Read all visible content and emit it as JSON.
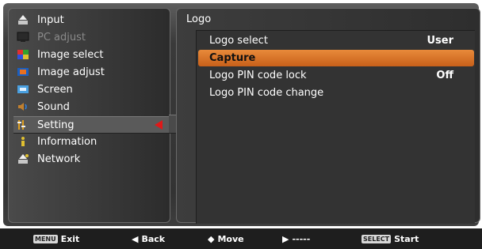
{
  "left_menu": {
    "items": [
      {
        "label": "Input",
        "icon": "input-icon",
        "disabled": false
      },
      {
        "label": "PC adjust",
        "icon": "pc-adjust-icon",
        "disabled": true
      },
      {
        "label": "Image select",
        "icon": "image-select-icon",
        "disabled": false
      },
      {
        "label": "Image adjust",
        "icon": "image-adjust-icon",
        "disabled": false
      },
      {
        "label": "Screen",
        "icon": "screen-icon",
        "disabled": false
      },
      {
        "label": "Sound",
        "icon": "sound-icon",
        "disabled": false
      },
      {
        "label": "Setting",
        "icon": "setting-icon",
        "disabled": false,
        "active": true
      },
      {
        "label": "Information",
        "icon": "information-icon",
        "disabled": false
      },
      {
        "label": "Network",
        "icon": "network-icon",
        "disabled": false
      }
    ]
  },
  "right_panel": {
    "title": "Logo",
    "items": [
      {
        "label": "Logo select",
        "value": "User"
      },
      {
        "label": "Capture",
        "value": "",
        "selected": true
      },
      {
        "label": "Logo PIN code lock",
        "value": "Off"
      },
      {
        "label": "Logo PIN code change",
        "value": ""
      }
    ]
  },
  "footer": {
    "menu_key": "MENU",
    "exit": "Exit",
    "back_glyph": "◀",
    "back": "Back",
    "move_glyph": "◆",
    "move": "Move",
    "next_glyph": "▶",
    "next": "-----",
    "select_key": "SELECT",
    "start": "Start"
  },
  "colors": {
    "selection": "#e07a2a",
    "pointer": "#e01818"
  }
}
